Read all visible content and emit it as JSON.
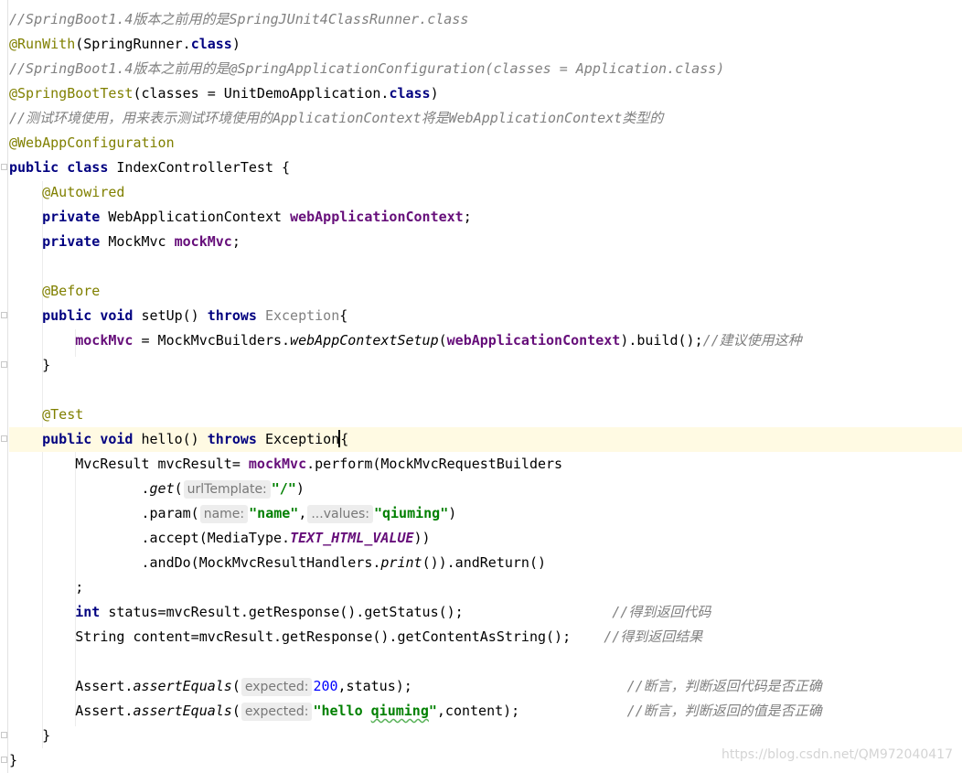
{
  "code": {
    "l1_comment": "//SpringBoot1.4版本之前用的是SpringJUnit4ClassRunner.class",
    "l2_annotation": "@RunWith",
    "l2_open": "(SpringRunner.",
    "l2_class_kw": "class",
    "l2_close": ")",
    "l3_comment": "//SpringBoot1.4版本之前用的是@SpringApplicationConfiguration(classes = Application.class)",
    "l4_annotation": "@SpringBootTest",
    "l4_open": "(classes = UnitDemoApplication.",
    "l4_class_kw": "class",
    "l4_close": ")",
    "l5_comment": "//测试环境使用，用来表示测试环境使用的ApplicationContext将是WebApplicationContext类型的",
    "l6_annotation": "@WebAppConfiguration",
    "l7_public": "public",
    "l7_class": "class",
    "l7_name": " IndexControllerTest {",
    "l8_annotation": "@Autowired",
    "l9_private": "private",
    "l9_type": " WebApplicationContext ",
    "l9_field": "webApplicationContext",
    "l9_end": ";",
    "l10_private": "private",
    "l10_type": " MockMvc ",
    "l10_field": "mockMvc",
    "l10_end": ";",
    "l12_annotation": "@Before",
    "l13_public": "public",
    "l13_void": "void",
    "l13_sig": " setUp() ",
    "l13_throws": "throws",
    "l13_exception": " Exception",
    "l13_brace": "{",
    "l14_field": "mockMvc",
    "l14_mid": " = MockMvcBuilders.",
    "l14_static": "webAppContextSetup",
    "l14_open": "(",
    "l14_arg": "webApplicationContext",
    "l14_end": ").build();",
    "l14_comment": "//建议使用这种",
    "l15_brace": "}",
    "l17_annotation": "@Test",
    "l18_public": "public",
    "l18_void": "void",
    "l18_sig": " hello() ",
    "l18_throws": "throws",
    "l18_exception": " Exception",
    "l18_brace": "{",
    "l19_start": "MvcResult mvcResult= ",
    "l19_field": "mockMvc",
    "l19_end": ".perform(MockMvcRequestBuilders",
    "l20_dot": ".",
    "l20_method": "get",
    "l20_open": "(",
    "l20_hint": "urlTemplate:",
    "l20_string": "\"/\"",
    "l20_close": ")",
    "l21_method": ".param(",
    "l21_hint1": "name:",
    "l21_string1": "\"name\"",
    "l21_comma": ",",
    "l21_hint2": "...values:",
    "l21_string2": "\"qiuming\"",
    "l21_close": ")",
    "l22_method": ".accept(MediaType.",
    "l22_const": "TEXT_HTML_VALUE",
    "l22_close": "))",
    "l23_method": ".andDo(MockMvcResultHandlers.",
    "l23_static": "print",
    "l23_end": "()).andReturn()",
    "l24_semi": ";",
    "l25_int": "int",
    "l25_code": " status=mvcResult.getResponse().getStatus();",
    "l25_comment": "//得到返回代码",
    "l26_code": "String content=mvcResult.getResponse().getContentAsString();",
    "l26_comment": "//得到返回结果",
    "l28_assert": "Assert.",
    "l28_method": "assertEquals",
    "l28_open": "(",
    "l28_hint": "expected:",
    "l28_number": "200",
    "l28_rest": ",status);",
    "l28_comment": "//断言，判断返回代码是否正确",
    "l29_assert": "Assert.",
    "l29_method": "assertEquals",
    "l29_open": "(",
    "l29_hint": "expected:",
    "l29_string_a": "\"hello ",
    "l29_string_b": "qiuming",
    "l29_string_c": "\"",
    "l29_rest": ",content);",
    "l29_comment": "//断言，判断返回的值是否正确",
    "l30_brace": "}",
    "l31_brace": "}"
  },
  "watermark": "https://blog.csdn.net/QM972040417",
  "colors": {
    "comment": "#808080",
    "annotation": "#808000",
    "keyword": "#000080",
    "field": "#660e7a",
    "string": "#008000",
    "number": "#0000ff",
    "current_line": "#fffae3"
  }
}
